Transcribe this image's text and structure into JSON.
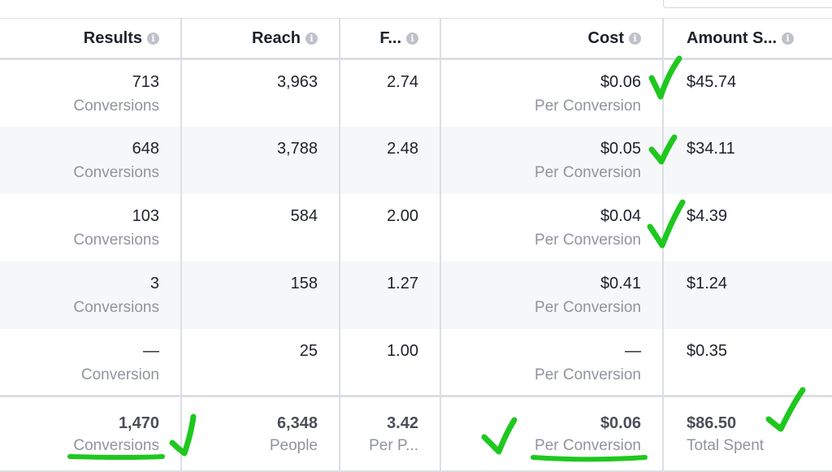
{
  "columns": [
    {
      "label": "Results",
      "align": "right",
      "info_icon": "info-icon"
    },
    {
      "label": "Reach",
      "align": "right",
      "info_icon": "info-icon"
    },
    {
      "label": "F...",
      "align": "right",
      "info_icon": "info-icon"
    },
    {
      "label": "Cost",
      "align": "right",
      "info_icon": "info-icon"
    },
    {
      "label": "Amount S...",
      "align": "left",
      "info_icon": "info-icon"
    }
  ],
  "rows": [
    {
      "results": "713",
      "results_unit": "Conversions",
      "reach": "3,963",
      "frequency": "2.74",
      "cost": "$0.06",
      "cost_unit": "Per Conversion",
      "amount": "$45.74"
    },
    {
      "results": "648",
      "results_unit": "Conversions",
      "reach": "3,788",
      "frequency": "2.48",
      "cost": "$0.05",
      "cost_unit": "Per Conversion",
      "amount": "$34.11"
    },
    {
      "results": "103",
      "results_unit": "Conversions",
      "reach": "584",
      "frequency": "2.00",
      "cost": "$0.04",
      "cost_unit": "Per Conversion",
      "amount": "$4.39"
    },
    {
      "results": "3",
      "results_unit": "Conversions",
      "reach": "158",
      "frequency": "1.27",
      "cost": "$0.41",
      "cost_unit": "Per Conversion",
      "amount": "$1.24"
    },
    {
      "results": "—",
      "results_unit": "Conversion",
      "reach": "25",
      "frequency": "1.00",
      "cost": "—",
      "cost_unit": "Per Conversion",
      "amount": "$0.35"
    }
  ],
  "totals": {
    "results": "1,470",
    "results_unit": "Conversions",
    "reach": "6,348",
    "reach_unit": "People",
    "frequency": "3.42",
    "frequency_unit": "Per P...",
    "cost": "$0.06",
    "cost_unit": "Per Conversion",
    "amount": "$86.50",
    "amount_unit": "Total Spent"
  },
  "colors": {
    "annotation_ink": "#1ec81e",
    "header_text": "#1d2129",
    "muted_text": "#90949c",
    "alt_row": "#f6f7f9"
  }
}
